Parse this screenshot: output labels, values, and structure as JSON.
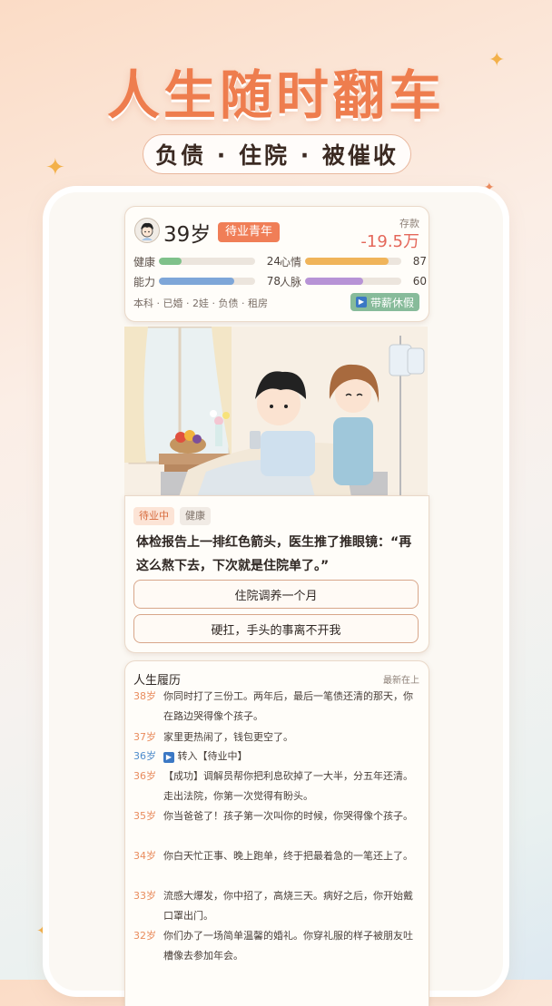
{
  "headline": "人生随时翻车",
  "subtitle": "负债 · 住院 · 被催收",
  "status": {
    "age": "39岁",
    "job_tag": "待业青年",
    "savings_label": "存款",
    "savings_value": "-19.5万",
    "stats": [
      {
        "label": "健康",
        "value": 24,
        "display": "24",
        "color": "#7fc18a"
      },
      {
        "label": "心情",
        "value": 87,
        "display": "87",
        "color": "#f0b45a"
      },
      {
        "label": "能力",
        "value": 78,
        "display": "78",
        "color": "#7ea6d8"
      },
      {
        "label": "人脉",
        "value": 60,
        "display": "60",
        "color": "#b793d6"
      }
    ],
    "traits": "本科 · 已婚 · 2娃 · 负债 · 租房",
    "leave_button": "带薪休假"
  },
  "event": {
    "chips": [
      "待业中",
      "健康"
    ],
    "text": "体检报告上一排红色箭头，医生推了推眼镜：“再这么熬下去，下次就是住院单了。”",
    "choices": [
      "住院调养一个月",
      "硬扛，手头的事离不开我"
    ]
  },
  "history": {
    "title": "人生履历",
    "order": "最新在上",
    "entries": [
      {
        "year": "38岁",
        "text": "你同时打了三份工。两年后，最后一笔债还清的那天，你在路边哭得像个孩子。",
        "type": "normal"
      },
      {
        "year": "37岁",
        "text": "家里更热闹了，钱包更空了。",
        "type": "normal"
      },
      {
        "year": "36岁",
        "text": "转入【待业中】",
        "type": "switch"
      },
      {
        "year": "36岁",
        "text": "【成功】调解员帮你把利息砍掉了一大半，分五年还清。走出法院，你第一次觉得有盼头。",
        "type": "normal"
      },
      {
        "year": "35岁",
        "text": "你当爸爸了！孩子第一次叫你的时候，你哭得像个孩子。",
        "type": "normal"
      },
      {
        "year": "34岁",
        "text": "你白天忙正事、晚上跑单，终于把最着急的一笔还上了。",
        "type": "normal"
      },
      {
        "year": "33岁",
        "text": "流感大爆发，你中招了，高烧三天。病好之后，你开始戴口罩出门。",
        "type": "normal"
      },
      {
        "year": "32岁",
        "text": "你们办了一场简单温馨的婚礼。你穿礼服的样子被朋友吐槽像去参加年会。",
        "type": "normal"
      }
    ]
  },
  "icons": {
    "sparkle": "sparkle-icon",
    "play": "play-icon",
    "avatar": "avatar-icon"
  }
}
